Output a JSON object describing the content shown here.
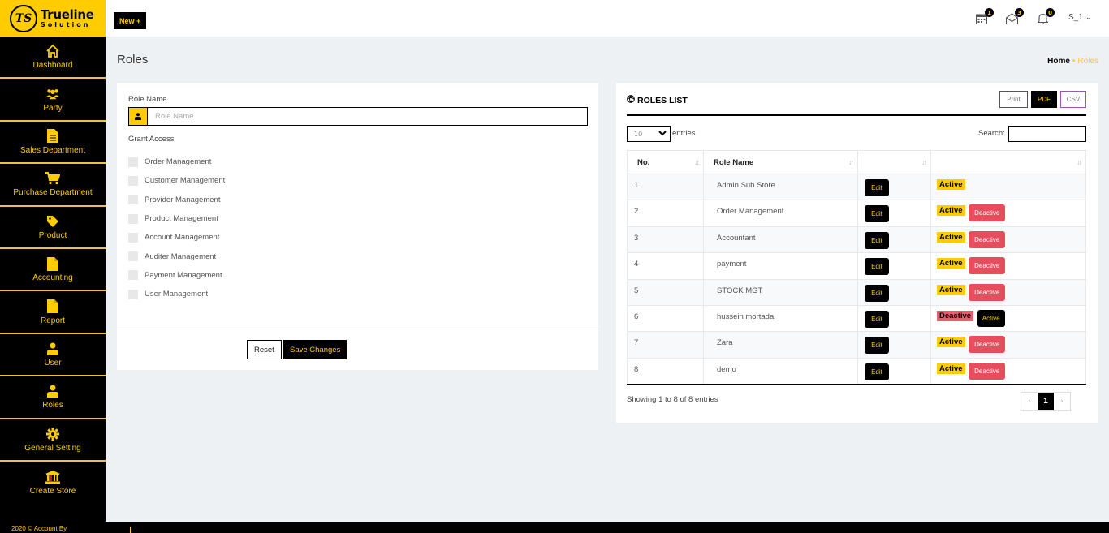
{
  "brand": {
    "logo_mark": "TS",
    "name_line1": "Trueline",
    "name_line2": "Solution"
  },
  "topbar": {
    "new_label": "New +",
    "icons": [
      {
        "name": "calendar-icon",
        "count": "1"
      },
      {
        "name": "envelope-icon",
        "count": "3"
      },
      {
        "name": "bell-icon",
        "count": "0"
      }
    ],
    "user": "S_1 ⌄"
  },
  "sidebar": {
    "items": [
      {
        "label": "Dashboard",
        "icon": "home-icon"
      },
      {
        "label": "Party",
        "icon": "users-icon"
      },
      {
        "label": "Sales Department",
        "icon": "document-icon"
      },
      {
        "label": "Purchase Department",
        "icon": "cart-icon"
      },
      {
        "label": "Product",
        "icon": "tag-icon"
      },
      {
        "label": "Accounting",
        "icon": "file-icon"
      },
      {
        "label": "Report",
        "icon": "file-icon"
      },
      {
        "label": "User",
        "icon": "user-icon"
      },
      {
        "label": "Roles",
        "icon": "user-icon"
      },
      {
        "label": "General Setting",
        "icon": "gear-icon"
      },
      {
        "label": "Create Store",
        "icon": "bank-icon"
      }
    ],
    "footer": "2020 © Account By"
  },
  "page": {
    "title": "Roles",
    "breadcrumb": {
      "home": "Home",
      "separator": "•",
      "current": "Roles"
    }
  },
  "form": {
    "role_name_label": "Role Name",
    "role_name_placeholder": "Role Name",
    "role_name_value": "",
    "grant_access_label": "Grant Access",
    "permissions": [
      "Order Management",
      "Customer Management",
      "Provider Management",
      "Product Management",
      "Account Management",
      "Auditer Management",
      "Payment Management",
      "User Management"
    ],
    "reset_label": "Reset",
    "save_label": "Save Changes"
  },
  "roles_list": {
    "title": "ROLES LIST",
    "export": {
      "print": "Print",
      "pdf": "PDF",
      "csv": "CSV"
    },
    "length_value": "10",
    "length_label": "entries",
    "search_label": "Search:",
    "search_value": "",
    "columns": [
      "No.",
      "Role Name",
      "",
      ""
    ],
    "rows": [
      {
        "no": "1",
        "name": "Admin Sub Store",
        "edit": "Edit",
        "status": "Active",
        "toggle": ""
      },
      {
        "no": "2",
        "name": "Order Management",
        "edit": "Edit",
        "status": "Active",
        "toggle": "Deactive"
      },
      {
        "no": "3",
        "name": "Accountant",
        "edit": "Edit",
        "status": "Active",
        "toggle": "Deactive"
      },
      {
        "no": "4",
        "name": "payment",
        "edit": "Edit",
        "status": "Active",
        "toggle": "Deactive"
      },
      {
        "no": "5",
        "name": "STOCK MGT",
        "edit": "Edit",
        "status": "Active",
        "toggle": "Deactive"
      },
      {
        "no": "6",
        "name": "hussein mortada",
        "edit": "Edit",
        "status": "Deactive",
        "toggle": "Active"
      },
      {
        "no": "7",
        "name": "Zara",
        "edit": "Edit",
        "status": "Active",
        "toggle": "Deactive"
      },
      {
        "no": "8",
        "name": "demo",
        "edit": "Edit",
        "status": "Active",
        "toggle": "Deactive"
      }
    ],
    "info": "Showing 1 to 8 of 8 entries",
    "pager": {
      "prev": "‹",
      "current": "1",
      "next": "›"
    }
  },
  "colors": {
    "accent": "#fecc00",
    "sidebar_bg": "#000000",
    "danger": "#e64e5e",
    "background": "#eef1f4"
  }
}
